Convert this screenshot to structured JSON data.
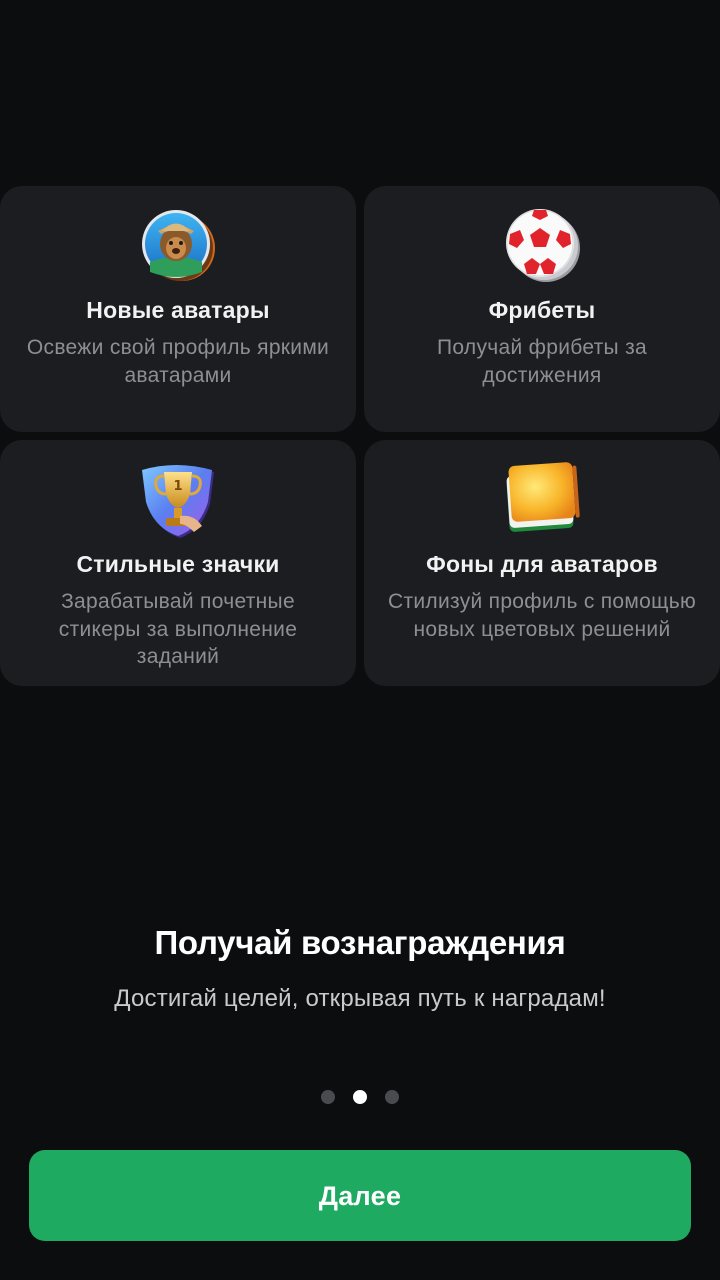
{
  "features": [
    {
      "title": "Новые аватары",
      "desc": "Освежи свой профиль яркими аватарами",
      "icon": "lion-avatar-icon"
    },
    {
      "title": "Фрибеты",
      "desc": "Получай фрибеты за достижения",
      "icon": "soccer-ball-coin-icon"
    },
    {
      "title": "Стильные значки",
      "desc": "Зарабатывай почетные стикеры за выполнение заданий",
      "icon": "trophy-badge-icon"
    },
    {
      "title": "Фоны для аватаров",
      "desc": "Стилизуй профиль с помощью новых цветовых решений",
      "icon": "color-swatch-stack-icon"
    }
  ],
  "onboarding": {
    "headline": "Получай вознаграждения",
    "subline": "Достигай целей, открывая путь к наградам!",
    "page_index": 2,
    "page_count": 3
  },
  "cta": {
    "label": "Далее"
  },
  "colors": {
    "background": "#0c0d0f",
    "card": "#1c1d20",
    "accent": "#1faa62",
    "muted_text": "#8e8f93"
  }
}
